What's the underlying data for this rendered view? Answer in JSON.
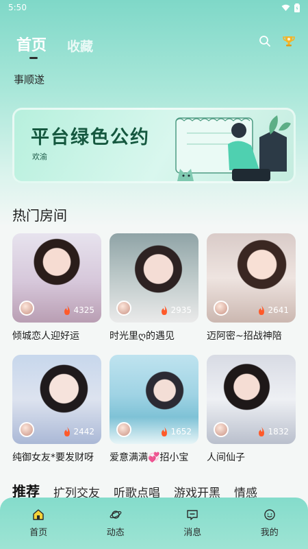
{
  "status": {
    "time": "5:50"
  },
  "header": {
    "tabs": [
      {
        "label": "首页",
        "active": true
      },
      {
        "label": "收藏",
        "active": false
      }
    ]
  },
  "notice": "事顺遂",
  "banner": {
    "title": "平台绿色公约",
    "subtitle": "欢渝"
  },
  "hot_rooms": {
    "title": "热门房间",
    "rooms": [
      {
        "name": "倾城恋人迎好运",
        "heat": "4325"
      },
      {
        "name": "时光里ღ的遇见",
        "heat": "2935"
      },
      {
        "name": "迈阿密~招战神陪",
        "heat": "2641"
      },
      {
        "name": "纯御女友*要发财呀",
        "heat": "2442"
      },
      {
        "name": "爱意满满💞招小宝",
        "heat": "1652"
      },
      {
        "name": "人间仙子",
        "heat": "1832"
      }
    ]
  },
  "categories": [
    "推荐",
    "扩列交友",
    "听歌点唱",
    "游戏开黑",
    "情感"
  ],
  "bottom_nav": [
    {
      "label": "首页",
      "icon": "home-icon",
      "active": true
    },
    {
      "label": "动态",
      "icon": "planet-icon"
    },
    {
      "label": "消息",
      "icon": "message-icon"
    },
    {
      "label": "我的",
      "icon": "profile-icon"
    }
  ],
  "colors": {
    "accent": "#7fd8c8",
    "banner_text": "#15583f",
    "flame": "#ff5a2a"
  }
}
